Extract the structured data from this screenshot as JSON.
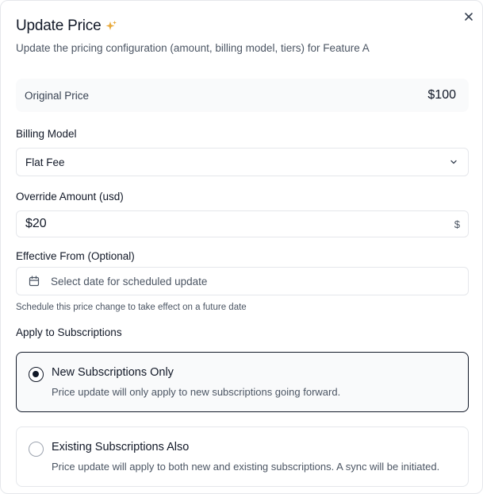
{
  "dialog": {
    "title": "Update Price",
    "subtitle": "Update the pricing configuration (amount, billing model, tiers) for Feature A",
    "close_icon": "close-icon",
    "title_icon": "sparkle-icon",
    "accent_color": "#e8a93a"
  },
  "original_price": {
    "label": "Original Price",
    "value": "$100"
  },
  "billing_model": {
    "label": "Billing Model",
    "value": "Flat Fee",
    "icon": "chevron-down-icon"
  },
  "override_amount": {
    "label": "Override Amount (usd)",
    "value": "$20",
    "suffix": "$"
  },
  "effective_from": {
    "label": "Effective From (Optional)",
    "placeholder": "Select date for scheduled update",
    "icon": "calendar-icon",
    "help": "Schedule this price change to take effect on a future date"
  },
  "apply": {
    "label": "Apply to Subscriptions",
    "options": [
      {
        "title": "New Subscriptions Only",
        "description": "Price update will only apply to new subscriptions going forward.",
        "selected": true
      },
      {
        "title": "Existing Subscriptions Also",
        "description": "Price update will apply to both new and existing subscriptions. A sync will be initiated.",
        "selected": false
      }
    ]
  }
}
